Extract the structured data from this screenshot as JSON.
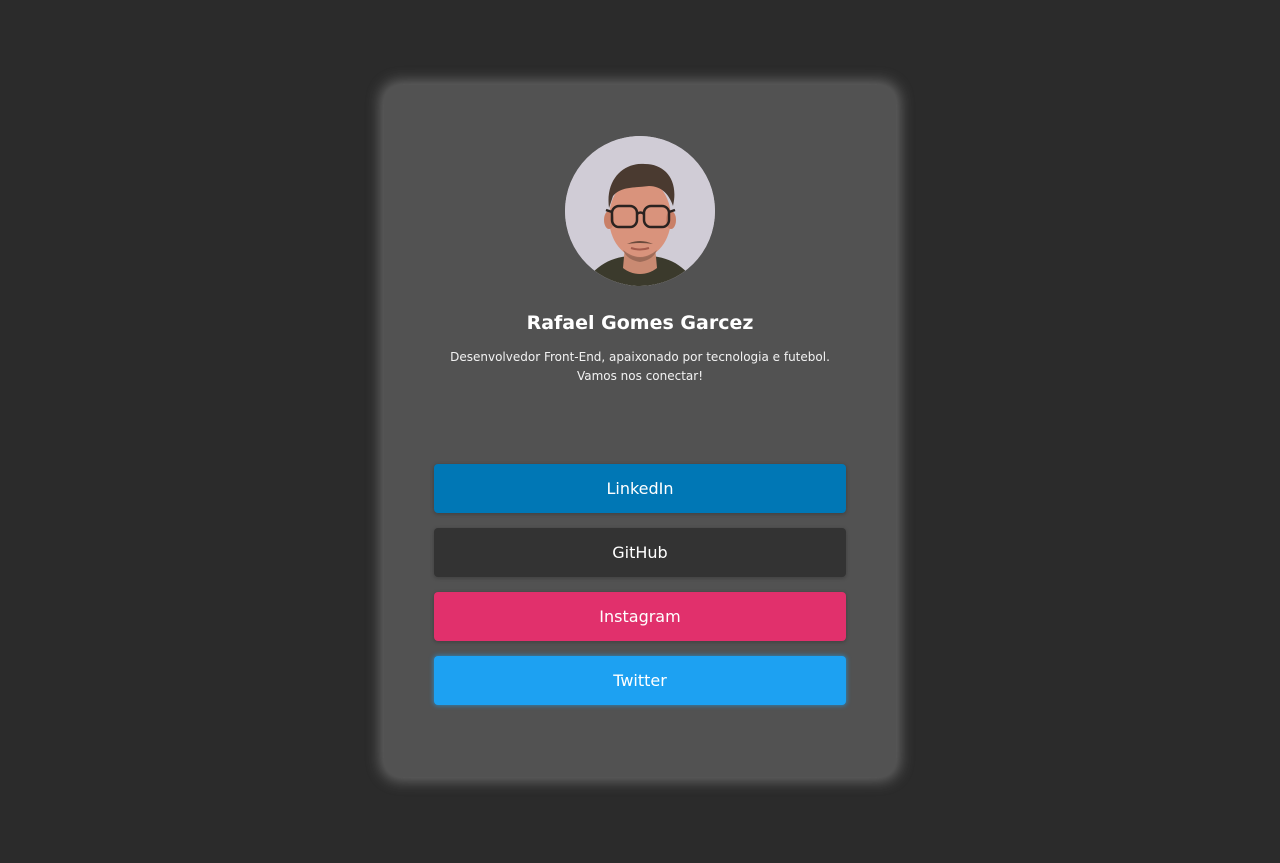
{
  "profile": {
    "name": "Rafael Gomes Garcez",
    "bio_line1": "Desenvolvedor Front-End, apaixonado por tecnologia e futebol.",
    "bio_line2": "Vamos nos conectar!",
    "avatar_alt": "avatar-photo"
  },
  "links": [
    {
      "label": "LinkedIn",
      "color": "#0077b5"
    },
    {
      "label": "GitHub",
      "color": "#333333"
    },
    {
      "label": "Instagram",
      "color": "#e1306c"
    },
    {
      "label": "Twitter",
      "color": "#1da1f2"
    }
  ],
  "theme": {
    "page_background": "#2b2b2b",
    "card_background": "#525252"
  }
}
